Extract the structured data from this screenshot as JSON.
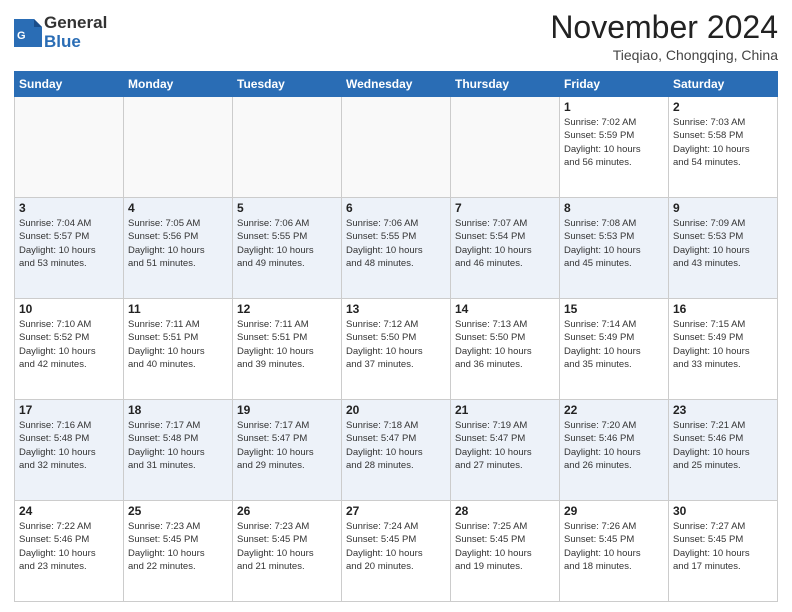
{
  "header": {
    "logo_general": "General",
    "logo_blue": "Blue",
    "month_title": "November 2024",
    "location": "Tieqiao, Chongqing, China"
  },
  "weekdays": [
    "Sunday",
    "Monday",
    "Tuesday",
    "Wednesday",
    "Thursday",
    "Friday",
    "Saturday"
  ],
  "weeks": [
    [
      {
        "day": "",
        "info": ""
      },
      {
        "day": "",
        "info": ""
      },
      {
        "day": "",
        "info": ""
      },
      {
        "day": "",
        "info": ""
      },
      {
        "day": "",
        "info": ""
      },
      {
        "day": "1",
        "info": "Sunrise: 7:02 AM\nSunset: 5:59 PM\nDaylight: 10 hours\nand 56 minutes."
      },
      {
        "day": "2",
        "info": "Sunrise: 7:03 AM\nSunset: 5:58 PM\nDaylight: 10 hours\nand 54 minutes."
      }
    ],
    [
      {
        "day": "3",
        "info": "Sunrise: 7:04 AM\nSunset: 5:57 PM\nDaylight: 10 hours\nand 53 minutes."
      },
      {
        "day": "4",
        "info": "Sunrise: 7:05 AM\nSunset: 5:56 PM\nDaylight: 10 hours\nand 51 minutes."
      },
      {
        "day": "5",
        "info": "Sunrise: 7:06 AM\nSunset: 5:55 PM\nDaylight: 10 hours\nand 49 minutes."
      },
      {
        "day": "6",
        "info": "Sunrise: 7:06 AM\nSunset: 5:55 PM\nDaylight: 10 hours\nand 48 minutes."
      },
      {
        "day": "7",
        "info": "Sunrise: 7:07 AM\nSunset: 5:54 PM\nDaylight: 10 hours\nand 46 minutes."
      },
      {
        "day": "8",
        "info": "Sunrise: 7:08 AM\nSunset: 5:53 PM\nDaylight: 10 hours\nand 45 minutes."
      },
      {
        "day": "9",
        "info": "Sunrise: 7:09 AM\nSunset: 5:53 PM\nDaylight: 10 hours\nand 43 minutes."
      }
    ],
    [
      {
        "day": "10",
        "info": "Sunrise: 7:10 AM\nSunset: 5:52 PM\nDaylight: 10 hours\nand 42 minutes."
      },
      {
        "day": "11",
        "info": "Sunrise: 7:11 AM\nSunset: 5:51 PM\nDaylight: 10 hours\nand 40 minutes."
      },
      {
        "day": "12",
        "info": "Sunrise: 7:11 AM\nSunset: 5:51 PM\nDaylight: 10 hours\nand 39 minutes."
      },
      {
        "day": "13",
        "info": "Sunrise: 7:12 AM\nSunset: 5:50 PM\nDaylight: 10 hours\nand 37 minutes."
      },
      {
        "day": "14",
        "info": "Sunrise: 7:13 AM\nSunset: 5:50 PM\nDaylight: 10 hours\nand 36 minutes."
      },
      {
        "day": "15",
        "info": "Sunrise: 7:14 AM\nSunset: 5:49 PM\nDaylight: 10 hours\nand 35 minutes."
      },
      {
        "day": "16",
        "info": "Sunrise: 7:15 AM\nSunset: 5:49 PM\nDaylight: 10 hours\nand 33 minutes."
      }
    ],
    [
      {
        "day": "17",
        "info": "Sunrise: 7:16 AM\nSunset: 5:48 PM\nDaylight: 10 hours\nand 32 minutes."
      },
      {
        "day": "18",
        "info": "Sunrise: 7:17 AM\nSunset: 5:48 PM\nDaylight: 10 hours\nand 31 minutes."
      },
      {
        "day": "19",
        "info": "Sunrise: 7:17 AM\nSunset: 5:47 PM\nDaylight: 10 hours\nand 29 minutes."
      },
      {
        "day": "20",
        "info": "Sunrise: 7:18 AM\nSunset: 5:47 PM\nDaylight: 10 hours\nand 28 minutes."
      },
      {
        "day": "21",
        "info": "Sunrise: 7:19 AM\nSunset: 5:47 PM\nDaylight: 10 hours\nand 27 minutes."
      },
      {
        "day": "22",
        "info": "Sunrise: 7:20 AM\nSunset: 5:46 PM\nDaylight: 10 hours\nand 26 minutes."
      },
      {
        "day": "23",
        "info": "Sunrise: 7:21 AM\nSunset: 5:46 PM\nDaylight: 10 hours\nand 25 minutes."
      }
    ],
    [
      {
        "day": "24",
        "info": "Sunrise: 7:22 AM\nSunset: 5:46 PM\nDaylight: 10 hours\nand 23 minutes."
      },
      {
        "day": "25",
        "info": "Sunrise: 7:23 AM\nSunset: 5:45 PM\nDaylight: 10 hours\nand 22 minutes."
      },
      {
        "day": "26",
        "info": "Sunrise: 7:23 AM\nSunset: 5:45 PM\nDaylight: 10 hours\nand 21 minutes."
      },
      {
        "day": "27",
        "info": "Sunrise: 7:24 AM\nSunset: 5:45 PM\nDaylight: 10 hours\nand 20 minutes."
      },
      {
        "day": "28",
        "info": "Sunrise: 7:25 AM\nSunset: 5:45 PM\nDaylight: 10 hours\nand 19 minutes."
      },
      {
        "day": "29",
        "info": "Sunrise: 7:26 AM\nSunset: 5:45 PM\nDaylight: 10 hours\nand 18 minutes."
      },
      {
        "day": "30",
        "info": "Sunrise: 7:27 AM\nSunset: 5:45 PM\nDaylight: 10 hours\nand 17 minutes."
      }
    ]
  ]
}
